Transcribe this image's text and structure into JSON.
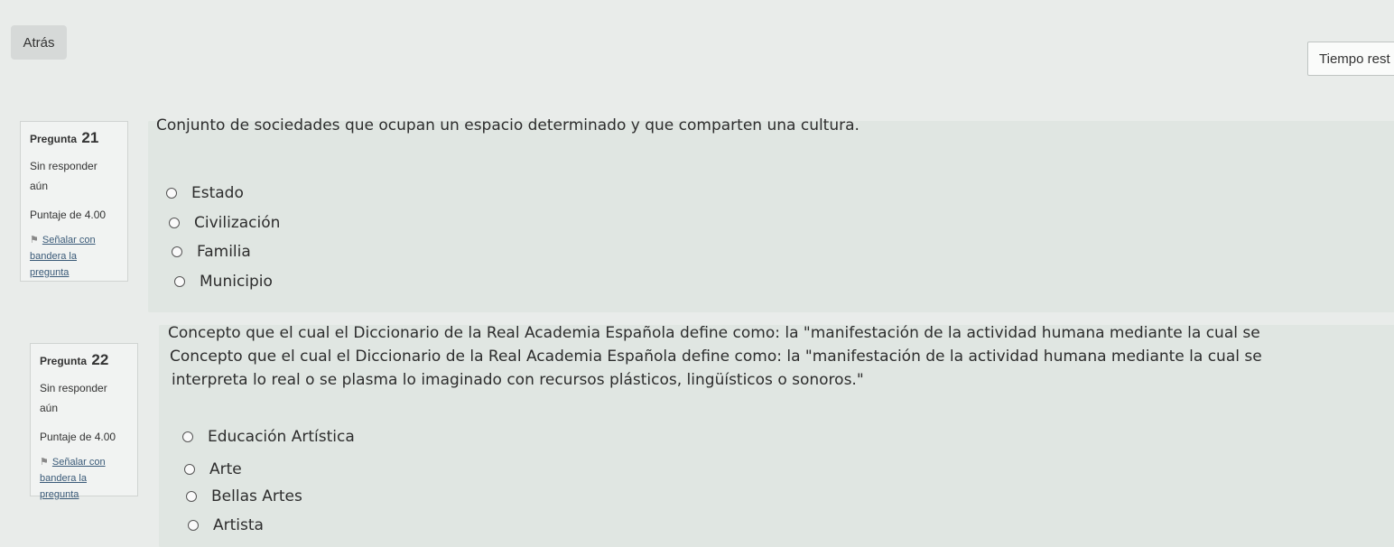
{
  "nav": {
    "back_label": "Atrás",
    "timer_label": "Tiempo rest"
  },
  "questions": [
    {
      "prefix": "Pregunta",
      "number": "21",
      "state_line1": "Sin responder",
      "state_line2": "aún",
      "grade": "Puntaje de 4.00",
      "flag_line1": "Señalar con",
      "flag_line2": "bandera la",
      "flag_line3": "pregunta",
      "text_lines": [
        "Conjunto de sociedades que ocupan un espacio determinado y que comparten una cultura."
      ],
      "options": [
        "Estado",
        "Civilización",
        "Familia",
        "Municipio"
      ]
    },
    {
      "prefix": "Pregunta",
      "number": "22",
      "state_line1": "Sin responder",
      "state_line2": "aún",
      "grade": "Puntaje de 4.00",
      "flag_line1": "Señalar con",
      "flag_line2": "bandera la",
      "flag_line3": "pregunta",
      "text_lines": [
        "Concepto que el cual el Diccionario de la Real Academia Española define como: la \"manifestación de la actividad humana mediante la cual se",
        "Concepto que el cual el Diccionario de la Real Academia Española define como: la \"manifestación de la actividad humana mediante la cual se",
        "interpreta lo real o se plasma lo imaginado con recursos plásticos, lingüísticos o sonoros.\""
      ],
      "options": [
        "Educación Artística",
        "Arte",
        "Bellas Artes",
        "Artista"
      ]
    }
  ]
}
